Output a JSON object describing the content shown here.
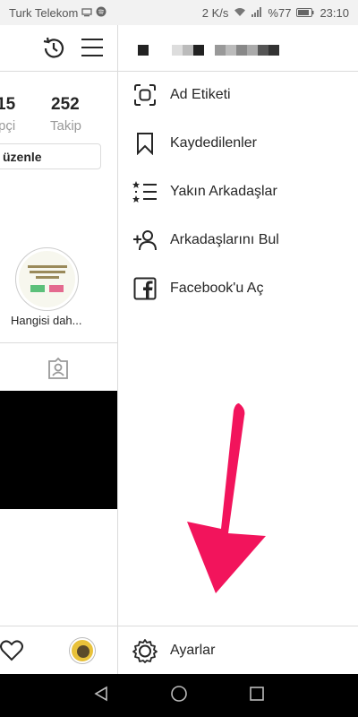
{
  "status_bar": {
    "carrier": "Turk Telekom",
    "speed": "2 K/s",
    "battery": "%77",
    "time": "23:10"
  },
  "profile": {
    "stat_followers_num": "15",
    "stat_followers_label": "pçi",
    "stat_following_num": "252",
    "stat_following_label": "Takip",
    "edit_button": "üzenle",
    "highlight_label": "Hangisi dah..."
  },
  "drawer": {
    "items": [
      {
        "label": "Ad Etiketi",
        "icon": "nametag-icon"
      },
      {
        "label": "Kaydedilenler",
        "icon": "bookmark-icon"
      },
      {
        "label": "Yakın Arkadaşlar",
        "icon": "close-friends-icon"
      },
      {
        "label": "Arkadaşlarını Bul",
        "icon": "add-person-icon"
      },
      {
        "label": "Facebook'u Aç",
        "icon": "facebook-icon"
      }
    ],
    "settings_label": "Ayarlar"
  },
  "colors": {
    "arrow": "#f2145c",
    "divider": "#dbdbdb",
    "text": "#262626"
  }
}
